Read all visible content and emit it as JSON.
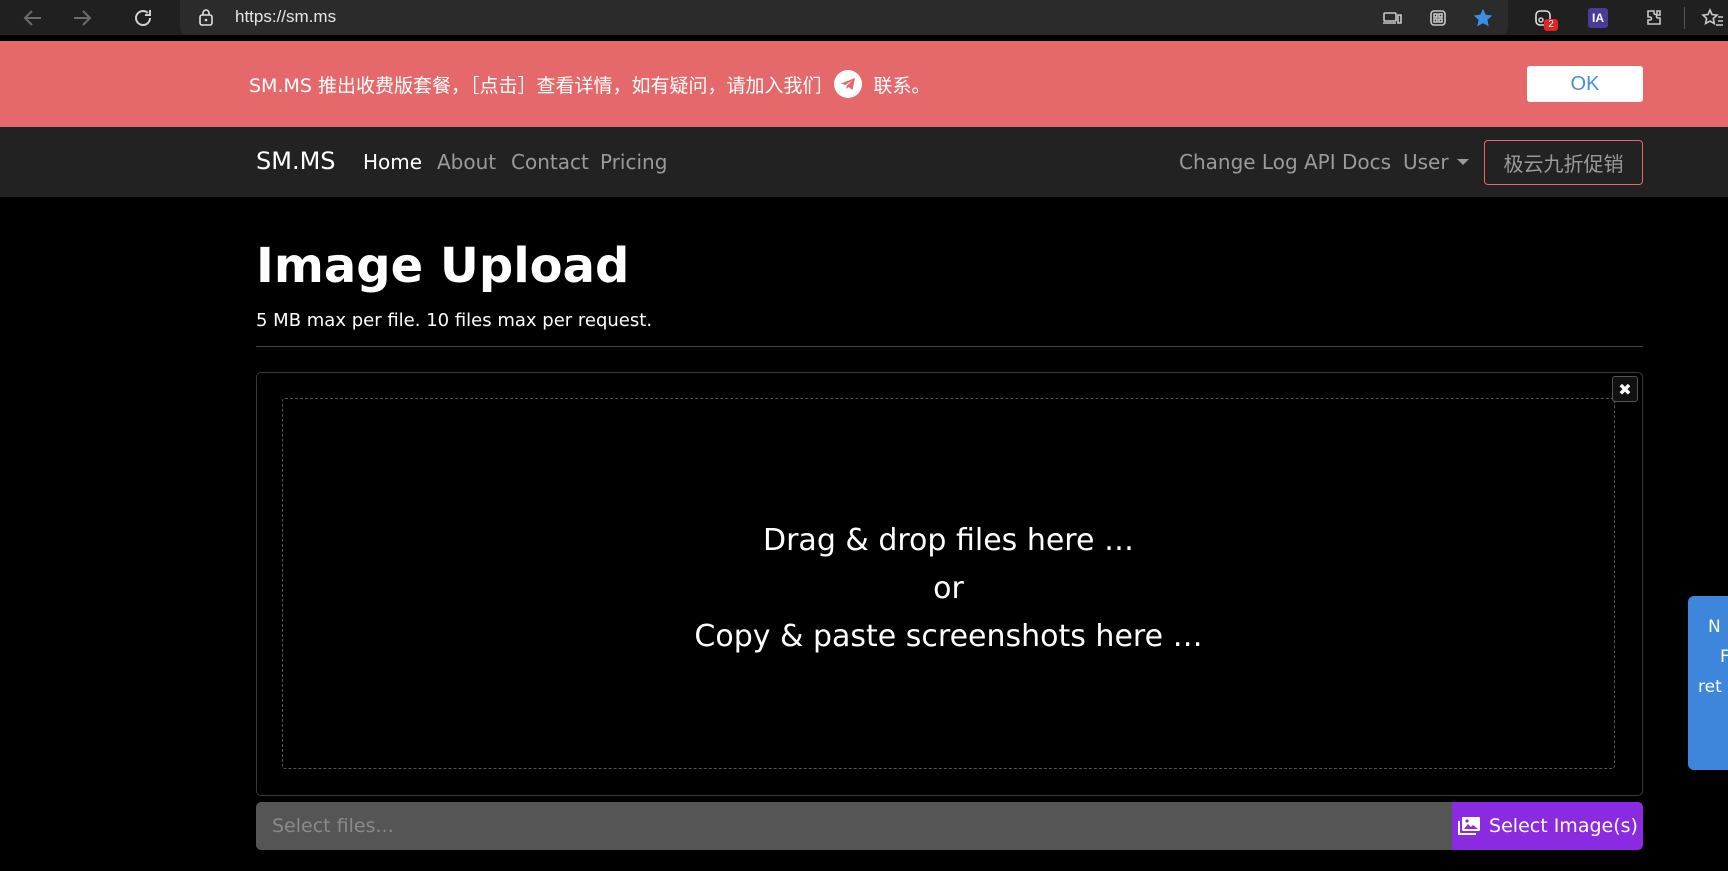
{
  "browser": {
    "url": "https://sm.ms",
    "extension_badge": "2",
    "ia_label": "IA"
  },
  "banner": {
    "text_before": "SM.MS 推出收费版套餐，［点击］查看详情，如有疑问，请加入我们",
    "text_after": "联系。",
    "ok_label": "OK",
    "background_color": "#e5696b"
  },
  "navbar": {
    "brand": "SM.MS",
    "left_links": [
      "Home",
      "About",
      "Contact",
      "Pricing"
    ],
    "right_links": [
      "Change Log",
      "API Docs"
    ],
    "user_menu": "User",
    "promo_label": "极云九折促销"
  },
  "main": {
    "title": "Image Upload",
    "subtitle": "5 MB max per file. 10 files max per request.",
    "close_label": "✖",
    "drop_lines": [
      "Drag & drop files here …",
      "or",
      "Copy & paste screenshots here …"
    ],
    "file_placeholder": "Select files...",
    "select_button": "Select Image(s)",
    "accent_color": "#8a2be2"
  },
  "side_tab": {
    "lines": [
      "N",
      "F",
      "",
      "ret"
    ],
    "color": "#3d86dc"
  }
}
